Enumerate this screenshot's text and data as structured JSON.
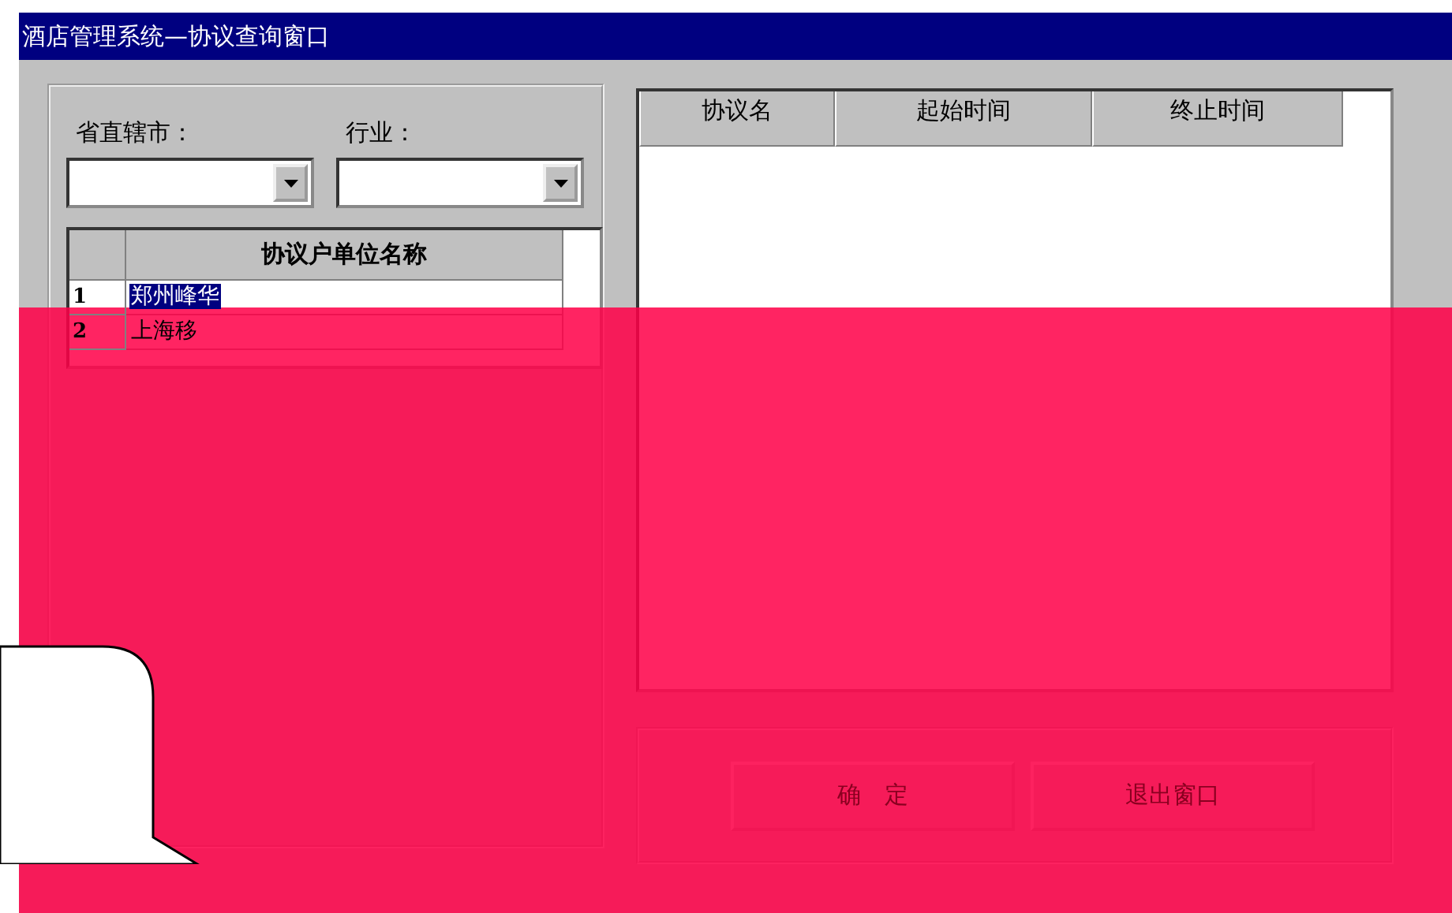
{
  "window": {
    "title": "酒店管理系统—协议查询窗口"
  },
  "filters": [
    {
      "label": "省直辖市："
    },
    {
      "label": "行业："
    }
  ],
  "units_table": {
    "columns": [
      "协议户单位名称"
    ],
    "rows": [
      {
        "number": "1",
        "name": "郑州峰华",
        "selected": true
      },
      {
        "number": "2",
        "name": "上海移",
        "selected": false
      }
    ]
  },
  "agreements_table": {
    "columns": [
      "协议名",
      "起始时间",
      "终止时间"
    ]
  },
  "buttons": [
    {
      "label": "确　定",
      "disabled": true
    },
    {
      "label": "退出窗口",
      "disabled": true
    }
  ]
}
